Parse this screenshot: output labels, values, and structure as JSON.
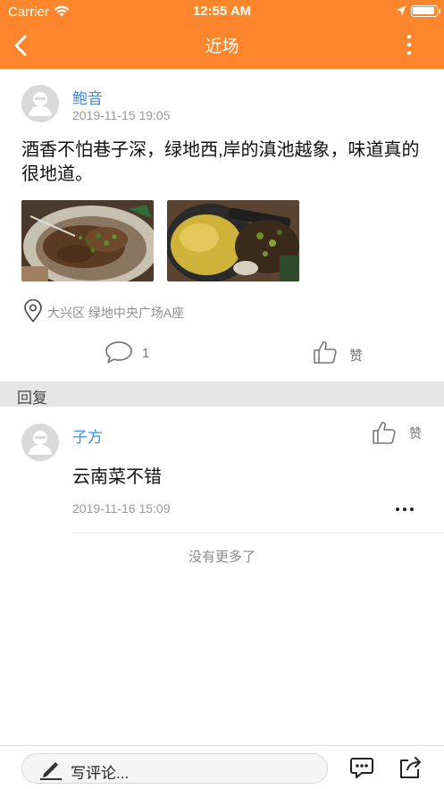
{
  "status_bar": {
    "carrier": "Carrier",
    "time": "12:55 AM"
  },
  "header": {
    "title": "近场",
    "bg_color": "#fd862c"
  },
  "post": {
    "author": "鲍音",
    "time": "2019-11-15 19:05",
    "text": "酒香不怕巷子深，绿地西,岸的滇池越象，味道真的很地道。",
    "photos": [
      "food-photo-1",
      "food-photo-2"
    ],
    "location": "大兴区 绿地中央广场A座",
    "comment_count": "1",
    "like_label": "赞"
  },
  "replies_section": {
    "title": "回复"
  },
  "replies": [
    {
      "author": "子方",
      "text": "云南菜不错",
      "time": "2019-11-16 15:09",
      "like_label": "赞"
    }
  ],
  "list_end": "没有更多了",
  "bottom_bar": {
    "comment_placeholder": "写评论..."
  }
}
